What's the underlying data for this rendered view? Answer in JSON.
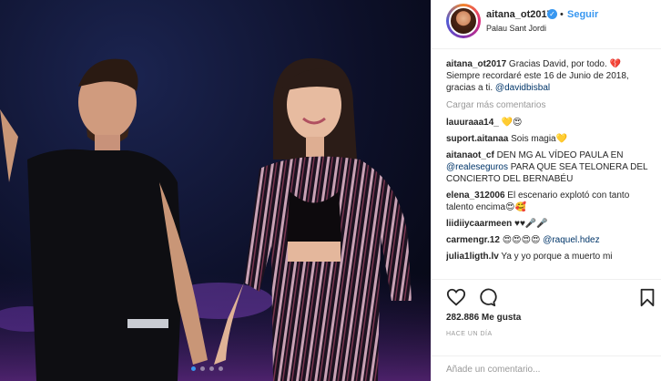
{
  "post": {
    "username": "aitana_ot2017",
    "verified_icon": "verified-badge-icon",
    "separator": "•",
    "follow_label": "Seguir",
    "location": "Palau Sant Jordi",
    "caption_user": "aitana_ot2017",
    "caption_text": " Gracias David, por todo. 💔 Siempre recordaré este 16 de Junio de 2018, gracias a ti. ",
    "caption_mention": "@davidbisbal",
    "load_more": "Cargar más comentarios",
    "comments": [
      {
        "user": "lauuraaa14_",
        "text": " 💛😍",
        "mention": "",
        "after": ""
      },
      {
        "user": "suport.aitanaa",
        "text": " Sois magia💛",
        "mention": "",
        "after": ""
      },
      {
        "user": "aitanaot_cf",
        "text": " DEN MG AL VÍDEO PAULA EN ",
        "mention": "@realeseguros",
        "after": " PARA QUE SEA TELONERA DEL CONCIERTO DEL BERNABÉU"
      },
      {
        "user": "elena_312006",
        "text": " El escenario explotó con tanto talento encima😍🥰",
        "mention": "",
        "after": ""
      },
      {
        "user": "liidiiycaarmeen",
        "text": " ♥♥🎤🎤",
        "mention": "",
        "after": ""
      },
      {
        "user": "carmengr.12",
        "text": " 😍😍😍😍 ",
        "mention": "@raquel.hdez",
        "after": ""
      },
      {
        "user": "julia1ligth.lv",
        "text": " Ya y yo porque a muerto mi",
        "mention": "",
        "after": ""
      }
    ],
    "likes": "282.886 Me gusta",
    "time": "HACE UN DÍA",
    "add_comment_placeholder": "Añade un comentario...",
    "carousel_total": 4,
    "carousel_active": 1
  },
  "colors": {
    "accent": "#3897f0",
    "mention": "#003569",
    "muted": "#999999",
    "text": "#262626"
  }
}
